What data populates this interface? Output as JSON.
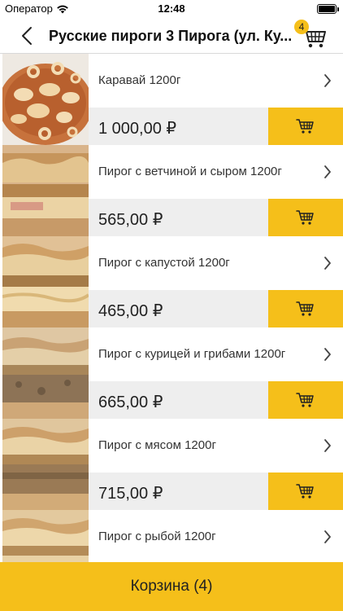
{
  "status_bar": {
    "carrier": "Оператор",
    "time": "12:48"
  },
  "header": {
    "title": "Русские пироги 3 Пирога (ул. Ку...",
    "cart_count": "4"
  },
  "products": [
    {
      "name": "Каравай 1200г",
      "price": "1 000,00 ₽"
    },
    {
      "name": "Пирог с ветчиной и сыром 1200г",
      "price": "565,00 ₽"
    },
    {
      "name": "Пирог с капустой 1200г",
      "price": "465,00 ₽"
    },
    {
      "name": "Пирог с курицей и грибами 1200г",
      "price": "665,00 ₽"
    },
    {
      "name": "Пирог с мясом 1200г",
      "price": "715,00 ₽"
    },
    {
      "name": "Пирог с рыбой 1200г",
      "price": ""
    }
  ],
  "footer": {
    "cart_label": "Корзина (4)"
  },
  "colors": {
    "accent": "#f5bf1a",
    "price_bg": "#eeeeee"
  },
  "icons": {
    "back": "chevron-left-icon",
    "cart": "shopping-cart-icon",
    "row": "chevron-right-icon"
  }
}
